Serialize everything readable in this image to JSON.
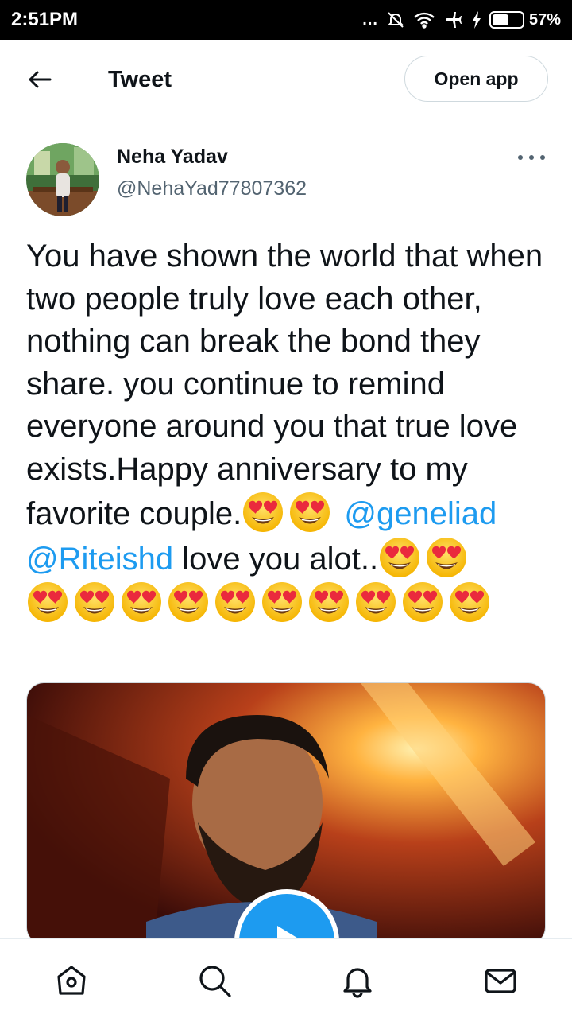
{
  "status_bar": {
    "time": "2:51PM",
    "dots": "...",
    "battery": "57%",
    "battery_level": 0.57
  },
  "header": {
    "title": "Tweet",
    "open_app_label": "Open app"
  },
  "tweet": {
    "author_name": "Neha Yadav",
    "author_handle": "@NehaYad77807362",
    "text_intro": "You have shown the world that when two people truly love each other, nothing can break the bond they share. you continue to remind everyone around you that true love exists.Happy anniversary to my favorite couple.",
    "mention_1": "@geneliad",
    "mention_2": "@Riteishd",
    "text_tail": " love you alot..",
    "emoji_name": "smiling-face-with-heart-eyes",
    "emoji_count_after_couple": 2,
    "emoji_count_after_alot": 2,
    "emoji_count_final": 10
  },
  "colors": {
    "link": "#1d9bf0",
    "text": "#0f1419",
    "secondary": "#536471"
  },
  "bottom_nav": {
    "icons": [
      "home-icon",
      "search-icon",
      "notifications-icon",
      "messages-icon"
    ]
  }
}
